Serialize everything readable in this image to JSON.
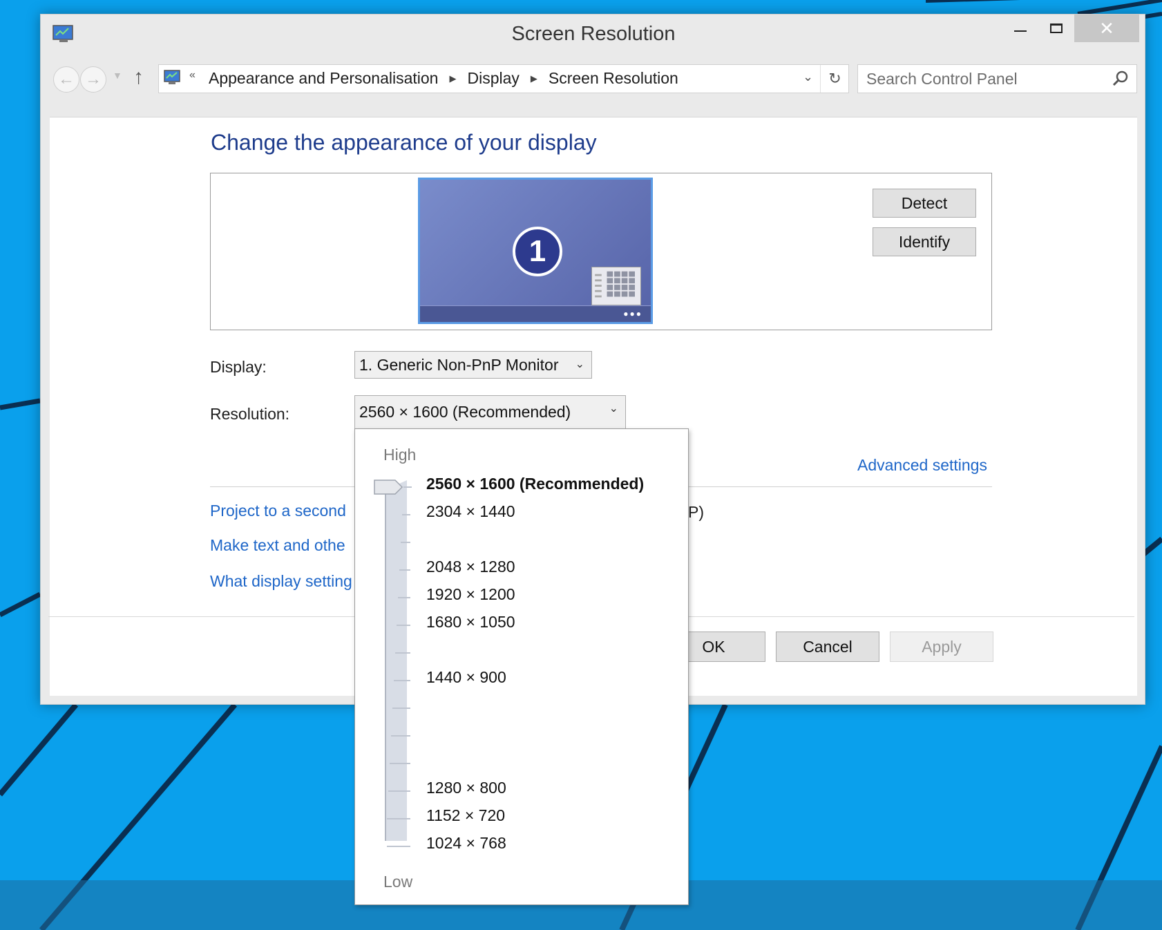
{
  "window": {
    "title": "Screen Resolution",
    "controls": {
      "minimize": "minimize",
      "maximize": "maximize",
      "close": "✕"
    }
  },
  "nav": {
    "back": "←",
    "forward": "→",
    "up": "↑",
    "overflow": "«",
    "breadcrumbs": [
      "Appearance and Personalisation",
      "Display",
      "Screen Resolution"
    ],
    "search_placeholder": "Search Control Panel"
  },
  "main": {
    "heading": "Change the appearance of your display",
    "monitor_number": "1",
    "detect_label": "Detect",
    "identify_label": "Identify",
    "display_label": "Display:",
    "display_value": "1. Generic Non-PnP Monitor",
    "resolution_label": "Resolution:",
    "resolution_value": "2560 × 1600 (Recommended)",
    "advanced_link": "Advanced settings",
    "link_project": "Project to a second",
    "link_project_tail": "P)",
    "link_maketext": "Make text and othe",
    "link_whatdisplay": "What display setting"
  },
  "footer": {
    "ok_label": "OK",
    "cancel_label": "Cancel",
    "apply_label": "Apply"
  },
  "resolution_dropdown": {
    "high_label": "High",
    "low_label": "Low",
    "options": [
      "2560 × 1600 (Recommended)",
      "2304 × 1440",
      "2048 × 1280",
      "1920 × 1200",
      "1680 × 1050",
      "1440 × 900",
      "1280 × 800",
      "1152 × 720",
      "1024 × 768"
    ],
    "selected_index": 0
  },
  "colors": {
    "desktop": "#0ea2ee",
    "heading": "#1e3c8c",
    "link": "#1e66c8"
  }
}
